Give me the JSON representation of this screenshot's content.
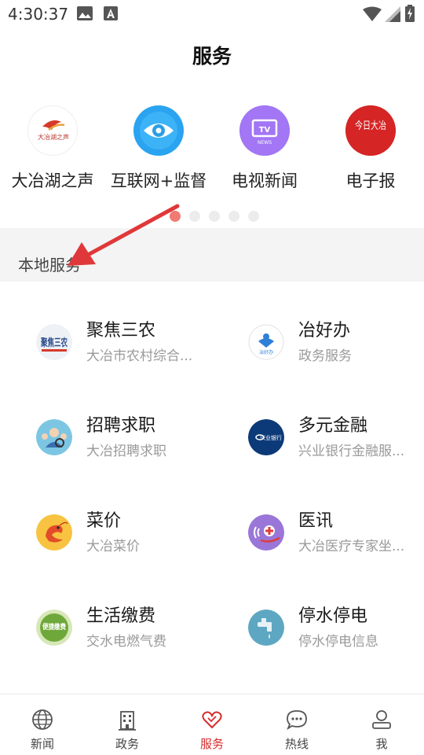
{
  "status_bar": {
    "time": "4:30:37"
  },
  "page": {
    "title": "服务"
  },
  "carousel": {
    "items": [
      {
        "label": "大冶湖之声",
        "icon": "radio-station-logo-icon",
        "logo_text": "大冶湖之声"
      },
      {
        "label": "互联网+监督",
        "icon": "eye-icon"
      },
      {
        "label": "电视新闻",
        "icon": "tv-news-icon",
        "logo_text": "NEWS"
      },
      {
        "label": "电子报",
        "icon": "newspaper-calligraphy-icon",
        "logo_text": "今日大冶"
      }
    ],
    "page_count": 5,
    "active_page": 1
  },
  "section": {
    "title": "本地服务"
  },
  "services": [
    {
      "title": "聚焦三农",
      "subtitle": "大冶市农村综合...",
      "icon": "agriculture-icon",
      "logo_text": "聚焦三农"
    },
    {
      "title": "冶好办",
      "subtitle": "政务服务",
      "icon": "government-service-icon",
      "logo_text": "冶好办"
    },
    {
      "title": "招聘求职",
      "subtitle": "大冶招聘求职",
      "icon": "job-recruitment-icon"
    },
    {
      "title": "多元金融",
      "subtitle": "兴业银行金融服...",
      "icon": "bank-icon",
      "logo_text": "兴业银行"
    },
    {
      "title": "菜价",
      "subtitle": "大冶菜价",
      "icon": "shrimp-icon"
    },
    {
      "title": "医讯",
      "subtitle": "大冶医疗专家坐...",
      "icon": "medical-icon"
    },
    {
      "title": "生活缴费",
      "subtitle": "交水电燃气费",
      "icon": "bill-payment-icon",
      "logo_text": "便捷缴费"
    },
    {
      "title": "停水停电",
      "subtitle": "停水停电信息",
      "icon": "water-tap-icon"
    }
  ],
  "bottom_nav": {
    "items": [
      {
        "label": "新闻",
        "icon": "globe-icon"
      },
      {
        "label": "政务",
        "icon": "building-icon"
      },
      {
        "label": "服务",
        "icon": "heart-icon",
        "active": true
      },
      {
        "label": "热线",
        "icon": "chat-bubble-icon"
      },
      {
        "label": "我",
        "icon": "person-icon"
      }
    ]
  },
  "colors": {
    "accent": "#d92a2a",
    "arrow": "#e0383a",
    "section_bg": "#f4f4f4",
    "subtitle": "#9a9a9a"
  }
}
